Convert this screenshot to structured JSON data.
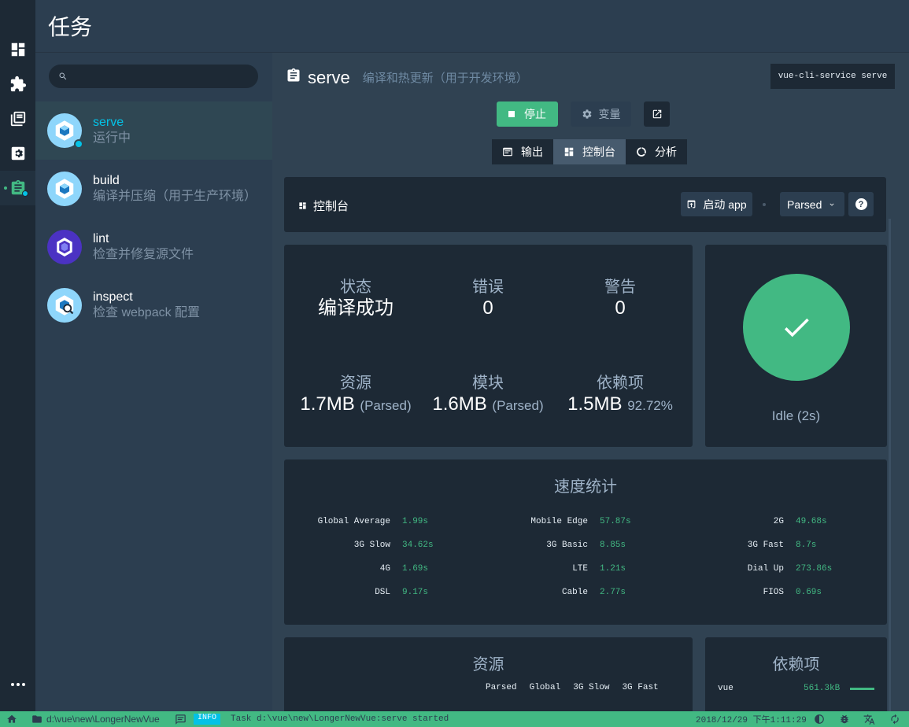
{
  "header": {
    "title": "任务"
  },
  "tasks": [
    {
      "name": "serve",
      "desc": "运行中"
    },
    {
      "name": "build",
      "desc": "编译并压缩（用于生产环境）"
    },
    {
      "name": "lint",
      "desc": "检查并修复源文件"
    },
    {
      "name": "inspect",
      "desc": "检查 webpack 配置"
    }
  ],
  "task_detail": {
    "name": "serve",
    "desc": "编译和热更新（用于开发环境）",
    "command": "vue-cli-service serve",
    "stop_label": "停止",
    "vars_label": "变量",
    "tabs": [
      "输出",
      "控制台",
      "分析"
    ]
  },
  "dashboard": {
    "title": "控制台",
    "launch_label": "启动 app",
    "mode_select": "Parsed"
  },
  "stats": {
    "status_label": "状态",
    "status_value": "编译成功",
    "errors_label": "错误",
    "errors_value": "0",
    "warnings_label": "警告",
    "warnings_value": "0",
    "assets_label": "资源",
    "assets_value": "1.7MB",
    "assets_unit": "(Parsed)",
    "modules_label": "模块",
    "modules_value": "1.6MB",
    "modules_unit": "(Parsed)",
    "deps_label": "依赖项",
    "deps_value": "1.5MB",
    "deps_pct": "92.72%"
  },
  "status_card": {
    "idle_text": "Idle (2s)"
  },
  "speed": {
    "title": "速度统计",
    "items": [
      {
        "k": "Global Average",
        "v": "1.99s"
      },
      {
        "k": "Mobile Edge",
        "v": "57.87s"
      },
      {
        "k": "2G",
        "v": "49.68s"
      },
      {
        "k": "3G Slow",
        "v": "34.62s"
      },
      {
        "k": "3G Basic",
        "v": "8.85s"
      },
      {
        "k": "3G Fast",
        "v": "8.7s"
      },
      {
        "k": "4G",
        "v": "1.69s"
      },
      {
        "k": "LTE",
        "v": "1.21s"
      },
      {
        "k": "Dial Up",
        "v": "273.86s"
      },
      {
        "k": "DSL",
        "v": "9.17s"
      },
      {
        "k": "Cable",
        "v": "2.77s"
      },
      {
        "k": "FIOS",
        "v": "0.69s"
      }
    ]
  },
  "assets": {
    "title": "资源",
    "columns": [
      "Parsed",
      "Global",
      "3G Slow",
      "3G Fast"
    ]
  },
  "deps": {
    "title": "依赖项",
    "items": [
      {
        "name": "vue",
        "size": "561.3kB",
        "share": 0.06
      }
    ]
  },
  "statusbar": {
    "path": "d:\\vue\\new\\LongerNewVue",
    "level": "INFO",
    "message": "Task d:\\vue\\new\\LongerNewVue:serve started",
    "time": "2018/12/29 下午1:11:29"
  },
  "colors": {
    "accent": "#42b983",
    "info": "#03c2e6",
    "bg": "#2c3e50",
    "card": "#1d2935"
  }
}
